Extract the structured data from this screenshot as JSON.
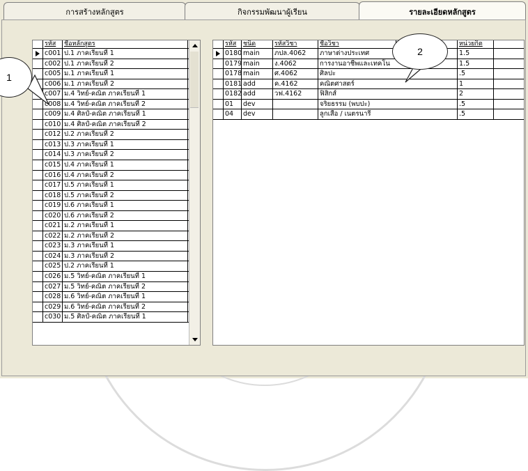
{
  "tabs": [
    {
      "label": "การสร้างหลักสูตร"
    },
    {
      "label": "กิจกรรมพัฒนาผู้เรียน"
    },
    {
      "label": "รายละเอียดหลักสูตร"
    }
  ],
  "curriculum_grid": {
    "columns": [
      "รหัส",
      "ชื่อหลักสูตร"
    ],
    "rows": [
      [
        "c001",
        "ป.1 ภาคเรียนที่ 1"
      ],
      [
        "c002",
        "ป.1 ภาคเรียนที่ 2"
      ],
      [
        "c005",
        "ม.1 ภาคเรียนที่ 1"
      ],
      [
        "c006",
        "ม.1 ภาคเรียนที่ 2"
      ],
      [
        "c007",
        "ม.4 วิทย์-คณิต ภาคเรียนที่ 1"
      ],
      [
        "c008",
        "ม.4 วิทย์-คณิต ภาคเรียนที่ 2"
      ],
      [
        "c009",
        "ม.4 ศิลป์-คณิต ภาคเรียนที่ 1"
      ],
      [
        "c010",
        "ม.4 ศิลป์-คณิต ภาคเรียนที่ 2"
      ],
      [
        "c012",
        "ป.2 ภาคเรียนที่ 2"
      ],
      [
        "c013",
        "ป.3 ภาคเรียนที่ 1"
      ],
      [
        "c014",
        "ป.3 ภาคเรียนที่ 2"
      ],
      [
        "c015",
        "ป.4 ภาคเรียนที่ 1"
      ],
      [
        "c016",
        "ป.4 ภาคเรียนที่ 2"
      ],
      [
        "c017",
        "ป.5 ภาคเรียนที่ 1"
      ],
      [
        "c018",
        "ป.5 ภาคเรียนที่ 2"
      ],
      [
        "c019",
        "ป.6 ภาคเรียนที่ 1"
      ],
      [
        "c020",
        "ป.6 ภาคเรียนที่ 2"
      ],
      [
        "c021",
        "ม.2 ภาคเรียนที่ 1"
      ],
      [
        "c022",
        "ม.2 ภาคเรียนที่ 2"
      ],
      [
        "c023",
        "ม.3 ภาคเรียนที่ 1"
      ],
      [
        "c024",
        "ม.3 ภาคเรียนที่ 2"
      ],
      [
        "c025",
        "ป.2 ภาคเรียนที่ 1"
      ],
      [
        "c026",
        "ม.5 วิทย์-คณิต ภาคเรียนที่ 1"
      ],
      [
        "c027",
        "ม.5 วิทย์-คณิต ภาคเรียนที่ 2"
      ],
      [
        "c028",
        "ม.6 วิทย์-คณิต ภาคเรียนที่ 1"
      ],
      [
        "c029",
        "ม.6 วิทย์-คณิต ภาคเรียนที่ 2"
      ],
      [
        "c030",
        "ม.5 ศิลป์-คณิต ภาคเรียนที่ 1"
      ]
    ]
  },
  "detail_grid": {
    "columns": [
      "รหัส",
      "ชนิด",
      "รหัสวิชา",
      "ชื่อวิชา",
      "",
      "หน่วยกิต"
    ],
    "rows": [
      [
        "0180",
        "main",
        "ภปล.4062",
        "ภาษาต่างประเทศ",
        "1.5"
      ],
      [
        "0179",
        "main",
        "ง.4062",
        "การงานอาชีพและเทคโน",
        "1.5"
      ],
      [
        "0178",
        "main",
        "ศ.4062",
        "ศิลปะ",
        ".5"
      ],
      [
        "0181",
        "add",
        "ค.4162",
        "คณิตศาสตร์",
        "1"
      ],
      [
        "0182",
        "add",
        "วฟ.4162",
        "ฟิสิกส์",
        "2"
      ],
      [
        "01",
        "dev",
        "",
        "จริยธรรม (พบปะ)",
        ".5"
      ],
      [
        "04",
        "dev",
        "",
        "ลูกเสือ / เนตรนารี",
        ".5"
      ]
    ]
  },
  "callouts": {
    "one": "1",
    "two": "2"
  }
}
